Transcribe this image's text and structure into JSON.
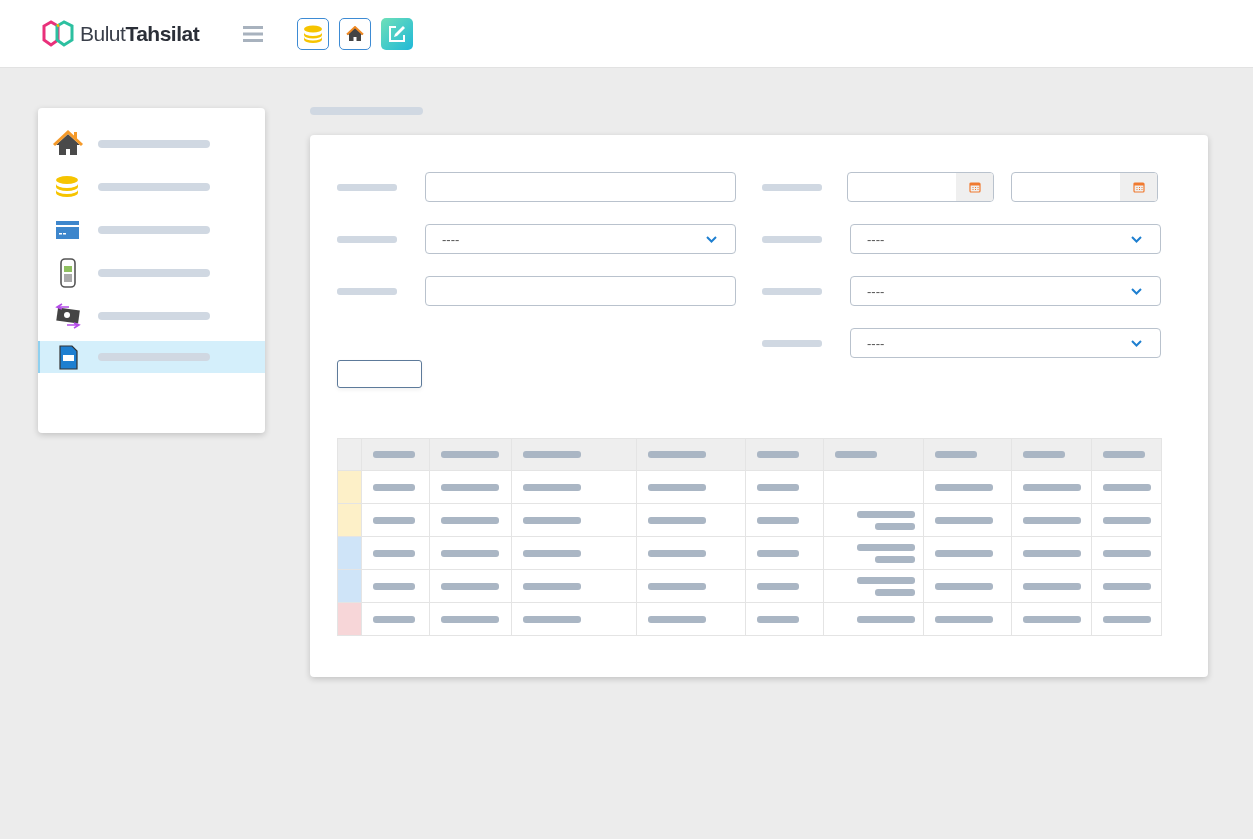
{
  "header": {
    "logo_text_light": "Bulut",
    "logo_text_bold": "Tahsilat",
    "toolbar": [
      {
        "kind": "coins"
      },
      {
        "kind": "home"
      },
      {
        "kind": "edit"
      }
    ]
  },
  "sidebar": {
    "items": [
      {
        "kind": "home",
        "selected": false
      },
      {
        "kind": "coins",
        "selected": false
      },
      {
        "kind": "card",
        "selected": false
      },
      {
        "kind": "pos",
        "selected": false
      },
      {
        "kind": "money",
        "selected": false
      },
      {
        "kind": "document",
        "selected": true
      }
    ]
  },
  "form": {
    "left": [
      {
        "kind": "text"
      },
      {
        "kind": "select",
        "value": "----"
      },
      {
        "kind": "text"
      }
    ],
    "right": [
      {
        "kind": "date"
      },
      {
        "kind": "select",
        "value": "----"
      },
      {
        "kind": "select",
        "value": "----"
      },
      {
        "kind": "select",
        "value": "----"
      }
    ]
  },
  "table": {
    "rows": [
      {
        "color": "#fdf0c8",
        "cell_6": {
          "kind": "empty"
        }
      },
      {
        "color": "#fdf0c8",
        "cell_6": {
          "kind": "double"
        }
      },
      {
        "color": "#cfe4f8",
        "cell_6": {
          "kind": "double"
        }
      },
      {
        "color": "#cfe4f8",
        "cell_6": {
          "kind": "double"
        }
      },
      {
        "color": "#f7d6d8",
        "cell_6": {
          "kind": "single"
        }
      }
    ]
  }
}
